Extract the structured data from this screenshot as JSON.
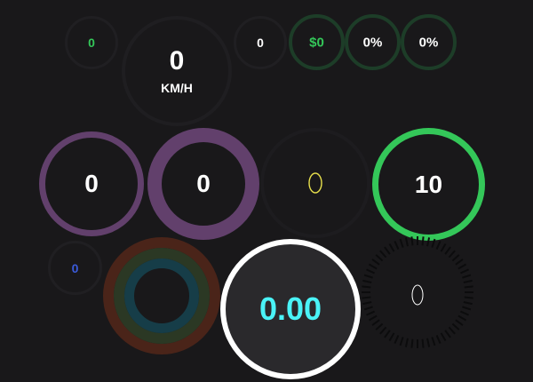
{
  "gauges": {
    "small_green": {
      "value": "0"
    },
    "speed": {
      "value": "0",
      "unit": "KM/H"
    },
    "small_white": {
      "value": "0"
    },
    "money": {
      "value": "$0"
    },
    "pct_a": {
      "value": "0%"
    },
    "pct_b": {
      "value": "0%"
    },
    "purple_thin": {
      "value": "0"
    },
    "purple_thick": {
      "value": "0"
    },
    "yellow_ring": {
      "value": "0"
    },
    "green_ten": {
      "value": "10"
    },
    "small_blue": {
      "value": "0"
    },
    "activity_rings": {
      "outer_level": 0,
      "middle_level": 0,
      "inner_level": 0
    },
    "decimal": {
      "value": "0.00"
    },
    "ticks": {
      "value": "0"
    }
  },
  "colors": {
    "background": "#19181a",
    "ring_dark": "#1f1e21",
    "green": "#34c759",
    "green_track": "#1d3d28",
    "purple": "#62406c",
    "yellow": "#e8e04c",
    "blue": "#3b5bdb",
    "cyan": "#4af3f7",
    "red_track": "#4a2419",
    "olive_track": "#2b3824",
    "teal_track": "#163d48"
  }
}
